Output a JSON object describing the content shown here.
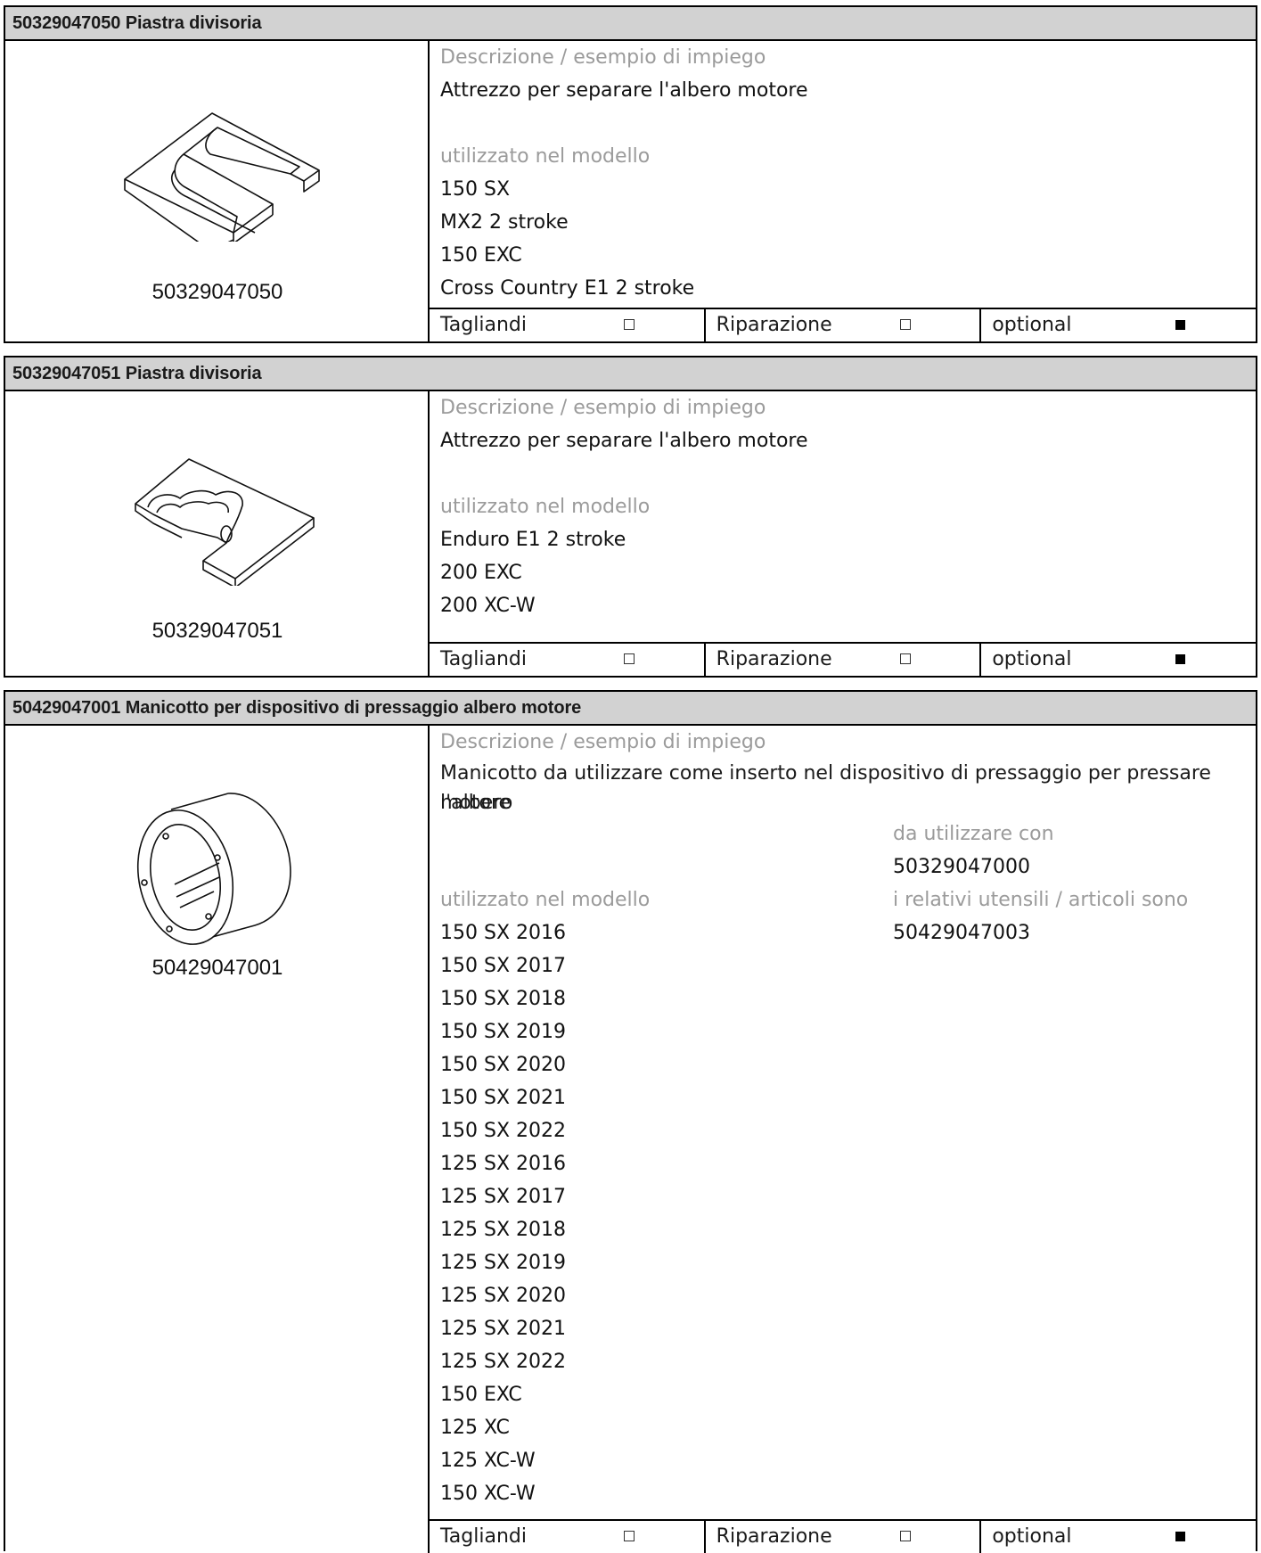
{
  "cards": [
    {
      "header": "50329047050 Piastra divisoria",
      "part_number": "50329047050",
      "illustration_icon": "divider-plate-icon",
      "description_label": "Descrizione / esempio di impiego",
      "description": "Attrezzo per separare l'albero motore",
      "models_label": "utilizzato nel modello",
      "models": [
        "150 SX",
        "MX2 2 stroke",
        "150 EXC",
        "Cross Country E1 2 stroke"
      ],
      "footer": [
        {
          "label": "Tagliandi",
          "checked": false
        },
        {
          "label": "Riparazione",
          "checked": false
        },
        {
          "label": "optional",
          "checked": true
        }
      ]
    },
    {
      "header": "50329047051 Piastra divisoria",
      "part_number": "50329047051",
      "illustration_icon": "divider-plate-icon",
      "description_label": "Descrizione / esempio di impiego",
      "description": "Attrezzo per separare l'albero motore",
      "models_label": "utilizzato nel modello",
      "models": [
        "Enduro E1 2 stroke",
        "200 EXC",
        "200 XC-W"
      ],
      "footer": [
        {
          "label": "Tagliandi",
          "checked": false
        },
        {
          "label": "Riparazione",
          "checked": false
        },
        {
          "label": "optional",
          "checked": true
        }
      ]
    },
    {
      "header": "50429047001 Manicotto per dispositivo di pressaggio albero motore",
      "part_number": "50429047001",
      "illustration_icon": "sleeve-icon",
      "description_label": "Descrizione / esempio di impiego",
      "description_line1": "Manicotto da utilizzare come inserto nel dispositivo di pressaggio per pressare l'albero",
      "description_line2": "motore",
      "use_with_label": "da utilizzare con",
      "use_with": "50329047000",
      "related_label": "i relativi utensili / articoli sono",
      "related": "50429047003",
      "models_label": "utilizzato nel modello",
      "models": [
        "150 SX 2016",
        "150 SX 2017",
        "150 SX 2018",
        "150 SX 2019",
        "150 SX 2020",
        "150 SX 2021",
        "150 SX 2022",
        "125 SX 2016",
        "125 SX 2017",
        "125 SX 2018",
        "125 SX 2019",
        "125 SX 2020",
        "125 SX 2021",
        "125 SX 2022",
        "150 EXC",
        "125 XC",
        "125 XC-W",
        "150 XC-W"
      ],
      "footer": [
        {
          "label": "Tagliandi",
          "checked": false
        },
        {
          "label": "Riparazione",
          "checked": false
        },
        {
          "label": "optional",
          "checked": true
        }
      ]
    }
  ],
  "checkbox_icons": {
    "unchecked": "empty-square-icon",
    "checked": "filled-square-icon"
  }
}
